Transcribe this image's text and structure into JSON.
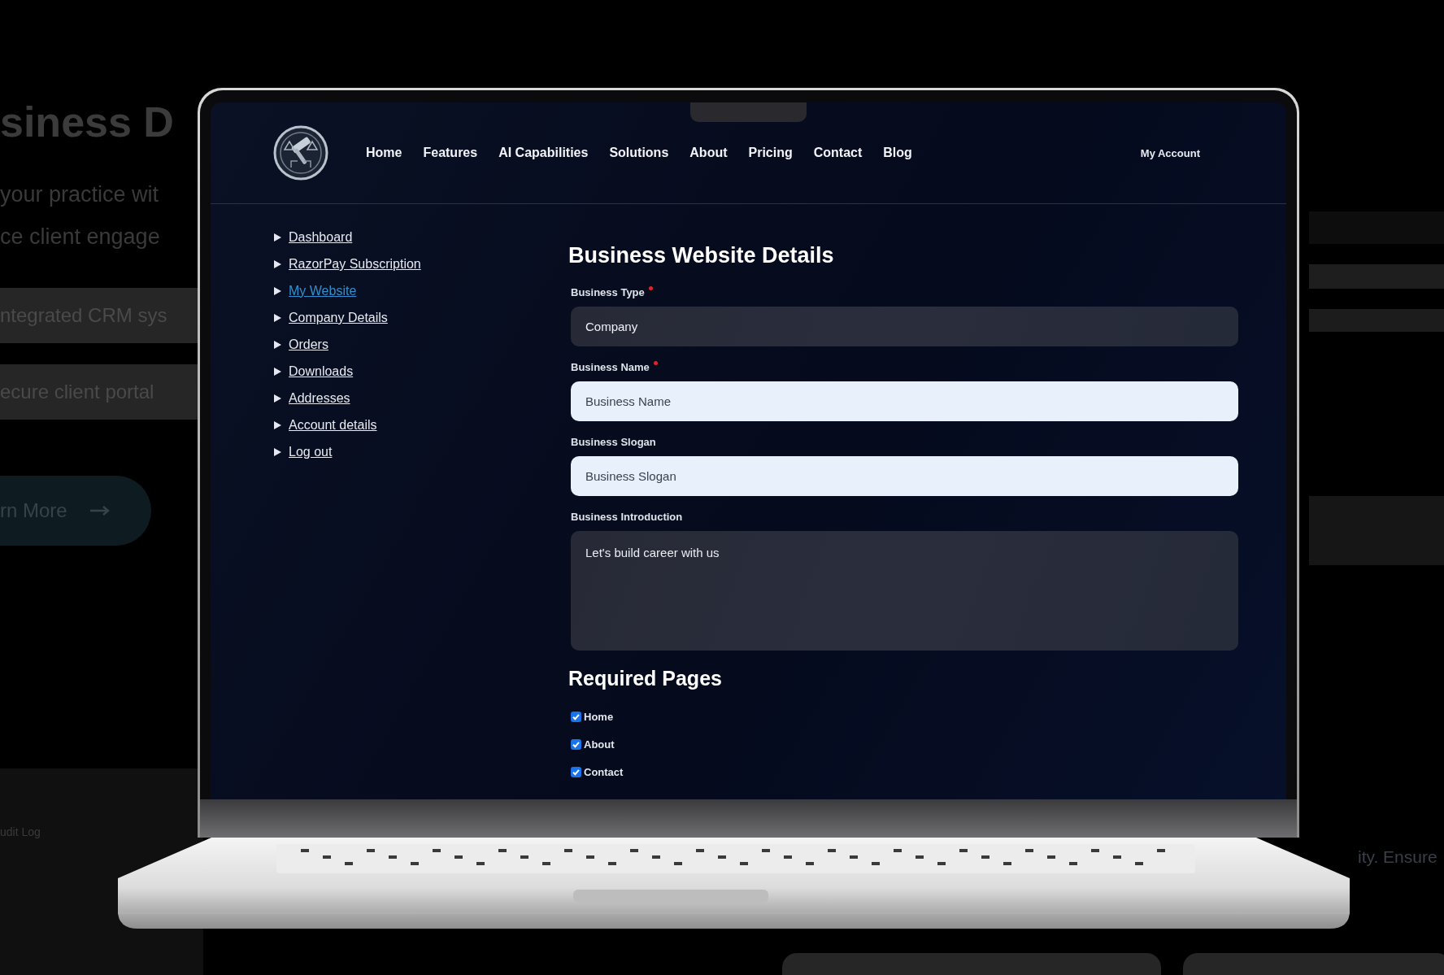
{
  "backdrop": {
    "heading": "siness D",
    "lines": [
      "your practice wit",
      "ce client engage"
    ],
    "features": [
      "ntegrated CRM sys",
      "ecure client portal"
    ],
    "button": {
      "label": "rn More"
    },
    "side_text": "ity. Ensure",
    "log_title": "udit Log"
  },
  "nav": {
    "links": [
      {
        "label": "Home"
      },
      {
        "label": "Features"
      },
      {
        "label": "AI Capabilities"
      },
      {
        "label": "Solutions"
      },
      {
        "label": "About"
      },
      {
        "label": "Pricing"
      },
      {
        "label": "Contact"
      },
      {
        "label": "Blog"
      }
    ],
    "account": "My Account"
  },
  "sidebar": {
    "items": [
      {
        "label": "Dashboard",
        "selected": false
      },
      {
        "label": "RazorPay Subscription",
        "selected": false
      },
      {
        "label": "My Website",
        "selected": true
      },
      {
        "label": "Company Details",
        "selected": false
      },
      {
        "label": "Orders",
        "selected": false
      },
      {
        "label": "Downloads",
        "selected": false
      },
      {
        "label": "Addresses",
        "selected": false
      },
      {
        "label": "Account details",
        "selected": false
      },
      {
        "label": "Log out",
        "selected": false
      }
    ]
  },
  "form": {
    "title": "Business Website Details",
    "fields": [
      {
        "kind": "select",
        "label": "Business Type",
        "required": true,
        "value": "Company"
      },
      {
        "kind": "input",
        "label": "Business Name",
        "required": true,
        "placeholder": "Business Name"
      },
      {
        "kind": "input",
        "label": "Business Slogan",
        "required": false,
        "placeholder": "Business Slogan"
      },
      {
        "kind": "textarea",
        "label": "Business Introduction",
        "required": false,
        "value": "Let's build career with us"
      }
    ],
    "pages_title": "Required Pages",
    "pages": [
      {
        "label": "Home",
        "checked": true
      },
      {
        "label": "About",
        "checked": true
      },
      {
        "label": "Contact",
        "checked": true
      }
    ]
  }
}
